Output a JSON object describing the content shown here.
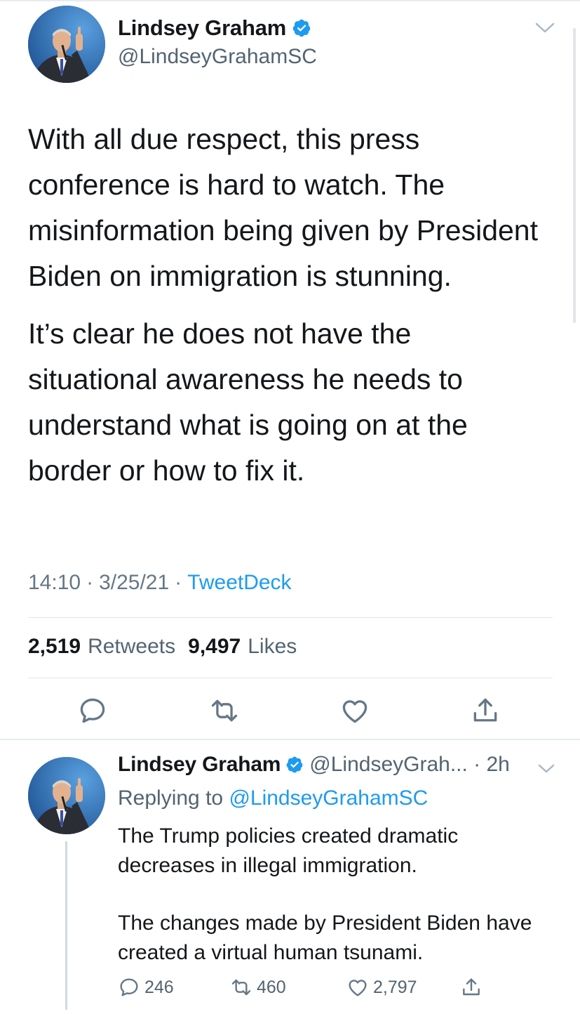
{
  "main_tweet": {
    "display_name": "Lindsey Graham",
    "handle": "@LindseyGrahamSC",
    "body": [
      "With all due respect, this press conference is hard to watch.  The misinformation being given by President Biden on immigration is stunning.",
      "It’s clear he does not have the situational awareness he needs to understand what is going on at the border or how to fix it."
    ],
    "time": "14:10",
    "date": "3/25/21",
    "separator": "·",
    "source": "TweetDeck",
    "retweets_count": "2,519",
    "retweets_label": "Retweets",
    "likes_count": "9,497",
    "likes_label": "Likes",
    "icons": [
      "reply-icon",
      "retweet-icon",
      "like-icon",
      "share-icon"
    ]
  },
  "reply_tweet": {
    "display_name": "Lindsey Graham",
    "handle_time": "@LindseyGrah... · 2h",
    "replying_prefix": "Replying to",
    "replying_handle": "@LindseyGrahamSC",
    "body": [
      "The Trump policies created dramatic decreases in illegal immigration.",
      "The changes made by President Biden have created a virtual human tsunami."
    ],
    "reply_count": "246",
    "retweet_count": "460",
    "like_count": "2,797"
  },
  "colors": {
    "accent": "#1d9bf0",
    "text": "#14171a",
    "secondary": "#536471",
    "divider": "#e1e5e8"
  }
}
